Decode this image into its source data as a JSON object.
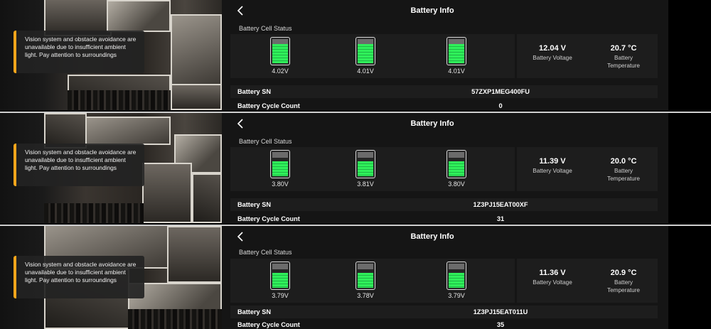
{
  "screens": [
    {
      "title": "Battery Info",
      "cell_status_label": "Battery Cell Status",
      "cells": [
        {
          "voltage": "4.02V",
          "level": 0.95
        },
        {
          "voltage": "4.01V",
          "level": 0.95
        },
        {
          "voltage": "4.01V",
          "level": 0.95
        }
      ],
      "battery_voltage": {
        "value": "12.04 V",
        "label": "Battery Voltage"
      },
      "battery_temperature": {
        "value": "20.7 °C",
        "label": "Battery Temperature"
      },
      "sn": {
        "label": "Battery SN",
        "value": "57ZXP1MEG400FU"
      },
      "cycle": {
        "label": "Battery Cycle Count",
        "value": "0"
      },
      "toast": "Vision system and obstacle avoidance are unavailable due to insufficient ambient light. Pay attention to surroundings"
    },
    {
      "title": "Battery Info",
      "cell_status_label": "Battery Cell Status",
      "cells": [
        {
          "voltage": "3.80V",
          "level": 0.75
        },
        {
          "voltage": "3.81V",
          "level": 0.75
        },
        {
          "voltage": "3.80V",
          "level": 0.75
        }
      ],
      "battery_voltage": {
        "value": "11.39 V",
        "label": "Battery Voltage"
      },
      "battery_temperature": {
        "value": "20.0 °C",
        "label": "Battery Temperature"
      },
      "sn": {
        "label": "Battery SN",
        "value": "1Z3PJ15EAT00XF"
      },
      "cycle": {
        "label": "Battery Cycle Count",
        "value": "31"
      },
      "toast": "Vision system and obstacle avoidance are unavailable due to insufficient ambient light. Pay attention to surroundings"
    },
    {
      "title": "Battery Info",
      "cell_status_label": "Battery Cell Status",
      "cells": [
        {
          "voltage": "3.79V",
          "level": 0.75
        },
        {
          "voltage": "3.78V",
          "level": 0.75
        },
        {
          "voltage": "3.79V",
          "level": 0.75
        }
      ],
      "battery_voltage": {
        "value": "11.36 V",
        "label": "Battery Voltage"
      },
      "battery_temperature": {
        "value": "20.9 °C",
        "label": "Battery Temperature"
      },
      "sn": {
        "label": "Battery SN",
        "value": "1Z3PJ15EAT011U"
      },
      "cycle": {
        "label": "Battery Cycle Count",
        "value": "35"
      },
      "toast": "Vision system and obstacle avoidance are unavailable due to insufficient ambient light. Pay attention to surroundings"
    }
  ],
  "colors": {
    "toast_accent": "#f5a51b",
    "cell_fill": "#2ff05a",
    "panel_bg": "#151515"
  }
}
